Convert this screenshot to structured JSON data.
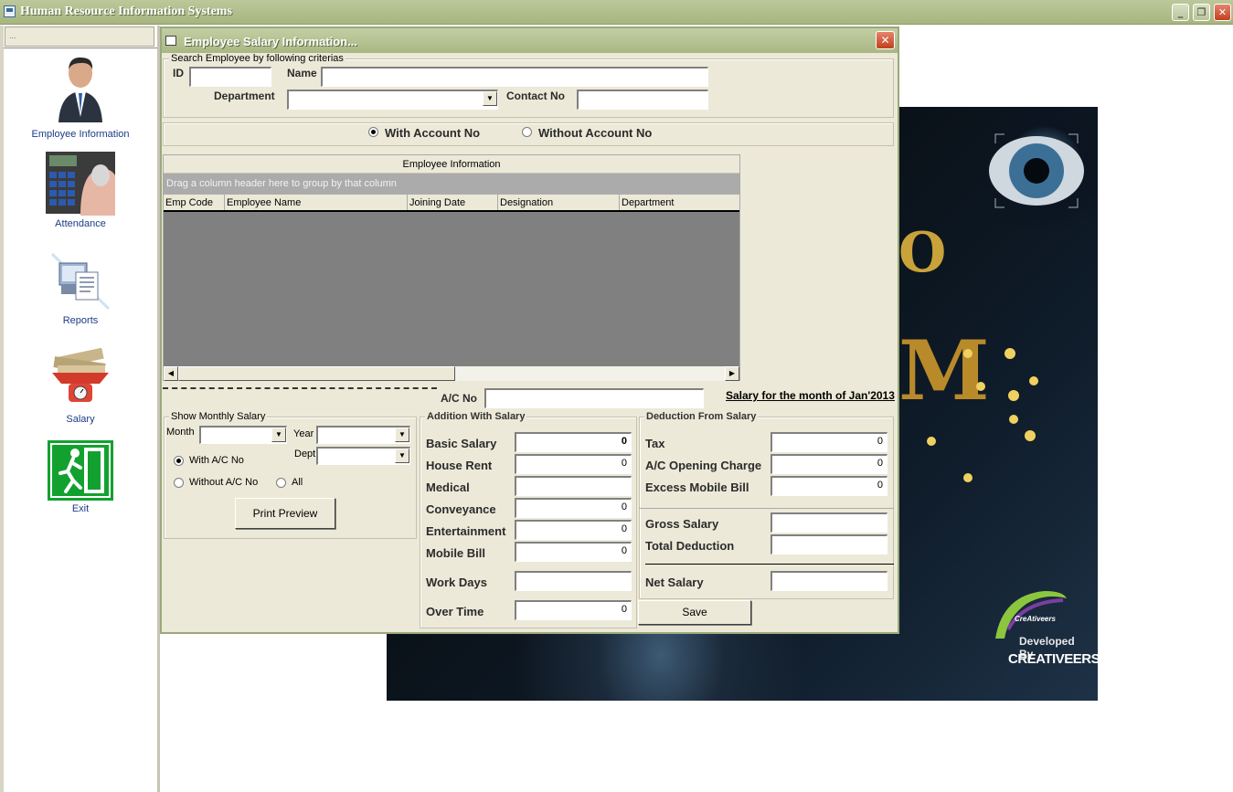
{
  "app": {
    "title": "Human Resource Information Systems",
    "min_glyph": "_",
    "max_glyph": "❐",
    "close_glyph": "✕"
  },
  "sidebar": {
    "head_text": "...",
    "items": [
      {
        "label": "Employee Information",
        "icon": "employee-icon"
      },
      {
        "label": "Attendance",
        "icon": "fingerprint-scanner-icon"
      },
      {
        "label": "Reports",
        "icon": "reports-icon"
      },
      {
        "label": "Salary",
        "icon": "money-scale-icon"
      },
      {
        "label": "Exit",
        "icon": "exit-sign-icon"
      }
    ]
  },
  "background": {
    "logo_line1": "CreAtiveers",
    "logo_line2": "Developed By",
    "logo_line3": "CREATIVEERS"
  },
  "dialog": {
    "title": "Employee Salary Information...",
    "close_glyph": "✕",
    "search": {
      "legend": "Search Employee by following criterias",
      "id_label": "ID",
      "id_value": "",
      "name_label": "Name",
      "name_value": "",
      "department_label": "Department",
      "department_value": "",
      "contact_label": "Contact No",
      "contact_value": ""
    },
    "account_filter": {
      "with_label": "With Account No",
      "without_label": "Without Account No",
      "selected": "with"
    },
    "grid": {
      "caption": "Employee Information",
      "group_hint": "Drag a column header here to group by that column",
      "columns": [
        "Emp Code",
        "Employee Name",
        "Joining Date",
        "Designation",
        "Department"
      ],
      "rows": []
    },
    "ac_no_label": "A/C No",
    "ac_no_value": "",
    "salary_month_text": "Salary for the month of Jan'2013",
    "monthly": {
      "legend": "Show Monthly Salary",
      "month_label": "Month",
      "month_value": "",
      "year_label": "Year",
      "year_value": "",
      "dept_label": "Dept",
      "dept_value": "",
      "with_ac_label": "With A/C No",
      "without_ac_label": "Without A/C No",
      "all_label": "All",
      "selected": "with",
      "print_preview_label": "Print Preview"
    },
    "addition": {
      "legend": "Addition With Salary",
      "basic_label": "Basic Salary",
      "basic_value": "0",
      "house_rent_label": "House Rent",
      "house_rent_value": "0",
      "medical_label": "Medical",
      "medical_value": "",
      "conveyance_label": "Conveyance",
      "conveyance_value": "0",
      "entertainment_label": "Entertainment",
      "entertainment_value": "0",
      "mobile_label": "Mobile Bill",
      "mobile_value": "0",
      "work_days_label": "Work Days",
      "work_days_value": "",
      "over_time_label": "Over Time",
      "over_time_value": "0"
    },
    "deduction": {
      "legend": "Deduction From Salary",
      "tax_label": "Tax",
      "tax_value": "0",
      "ac_open_label": "A/C Opening Charge",
      "ac_open_value": "0",
      "excess_label": "Excess Mobile Bill",
      "excess_value": "0",
      "gross_label": "Gross Salary",
      "gross_value": "",
      "total_ded_label": "Total Deduction",
      "total_ded_value": "",
      "net_label": "Net Salary",
      "net_value": ""
    },
    "save_label": "Save"
  }
}
